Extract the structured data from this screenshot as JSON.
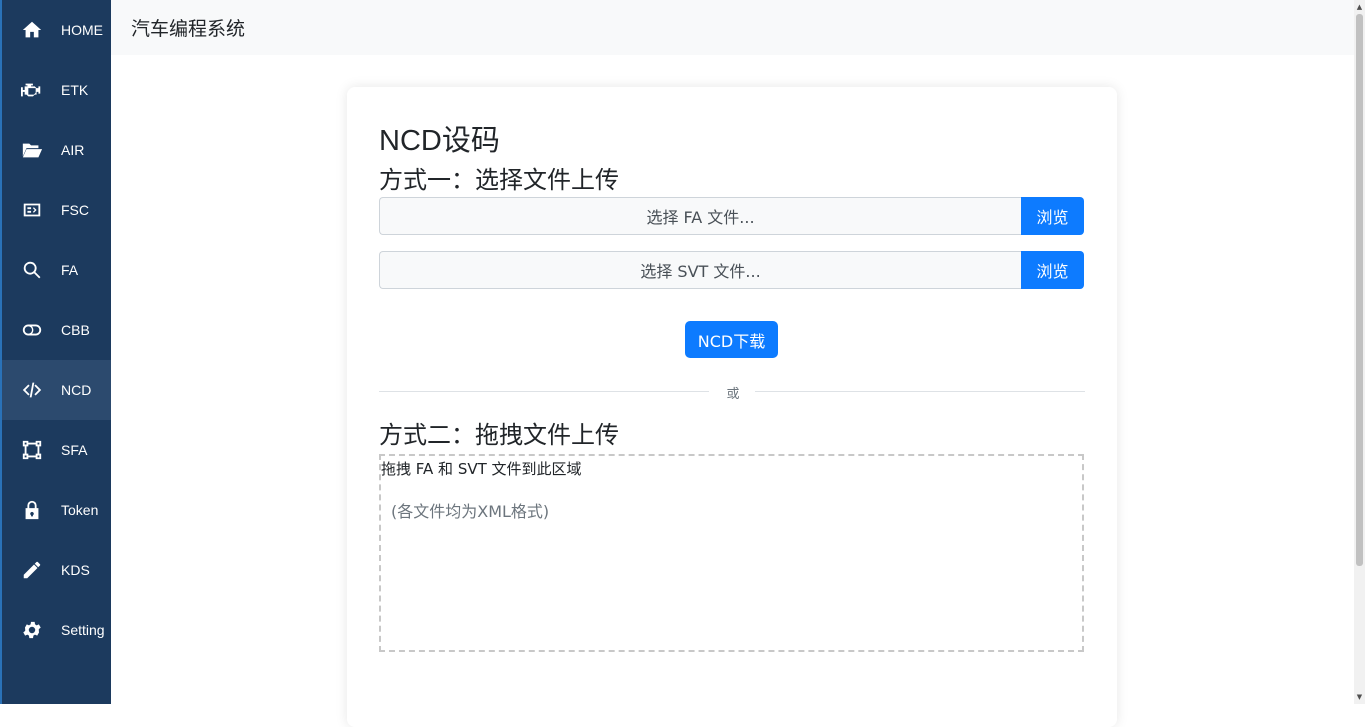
{
  "app": {
    "title": "汽车编程系统"
  },
  "sidebar": {
    "items": [
      {
        "label": "HOME",
        "icon": "home-icon"
      },
      {
        "label": "ETK",
        "icon": "engine-icon"
      },
      {
        "label": "AIR",
        "icon": "folder-open-icon"
      },
      {
        "label": "FSC",
        "icon": "chip-icon"
      },
      {
        "label": "FA",
        "icon": "search-icon"
      },
      {
        "label": "CBB",
        "icon": "toggle-icon"
      },
      {
        "label": "NCD",
        "icon": "code-icon",
        "active": true
      },
      {
        "label": "SFA",
        "icon": "vector-square-icon"
      },
      {
        "label": "Token",
        "icon": "lock-icon"
      },
      {
        "label": "KDS",
        "icon": "pencil-icon"
      },
      {
        "label": "Setting",
        "icon": "gear-icon"
      }
    ]
  },
  "card": {
    "title": "NCD设码",
    "method1": {
      "title": "方式一：选择文件上传",
      "fa_placeholder": "选择 FA 文件...",
      "svt_placeholder": "选择 SVT 文件...",
      "browse_label": "浏览",
      "download_label": "NCD下载"
    },
    "divider_text": "或",
    "method2": {
      "title": "方式二：拖拽文件上传",
      "drop_text": "拖拽 FA 和 SVT 文件到此区域",
      "drop_hint": "(各文件均为XML格式)"
    }
  },
  "colors": {
    "sidebar_bg": "#1c3a5e",
    "sidebar_active": "#2c4a6e",
    "primary": "#0d7bff",
    "topbar_bg": "#f8f9fa"
  }
}
